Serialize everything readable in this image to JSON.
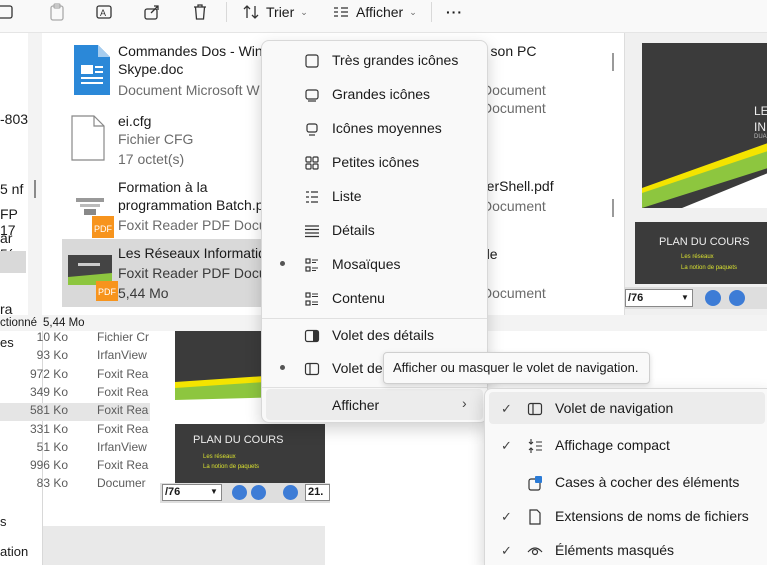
{
  "toolbar": {
    "sort_label": "Trier",
    "view_label": "Afficher",
    "more_label": "···"
  },
  "left_fragments": [
    "-803",
    "5 nf",
    "FP 17",
    "ar 5(",
    "ra Ph"
  ],
  "files": [
    {
      "name1": "Commandes Dos - Win",
      "name2": "Skype.doc",
      "sub1": "Document Microsoft W",
      "sub2": "",
      "icon": "word-doc-icon"
    },
    {
      "name1": "ei.cfg",
      "name2": "",
      "sub1": "Fichier CFG",
      "sub2": "17 octet(s)",
      "icon": "generic-file-icon"
    },
    {
      "name1": "Formation à la",
      "name2": "programmation Batch.p",
      "sub1": "Foxit Reader PDF Docu",
      "sub2": "",
      "icon": "pdf-file-icon"
    },
    {
      "name1": "Les Réseaux Informatiqu",
      "name2": "",
      "sub1": "Foxit Reader PDF Docur",
      "sub2": "5,44 Mo",
      "icon": "pdf-presentation-icon"
    }
  ],
  "right_fragments": {
    "r1": "r son PC",
    "r2": "Document",
    "r3": "Document",
    "r4": "rerShell.pdf",
    "r5": "Document",
    "r6": "de",
    "r7": "Document"
  },
  "status_bar": {
    "selected": "ctionné",
    "size": "5,44 Mo"
  },
  "lower_list": [
    {
      "size": "10 Ko",
      "app": "Fichier Cr"
    },
    {
      "size": "93 Ko",
      "app": "IrfanView"
    },
    {
      "size": "972 Ko",
      "app": "Foxit Rea"
    },
    {
      "size": "349 Ko",
      "app": "Foxit Rea"
    },
    {
      "size": "581 Ko",
      "app": "Foxit Rea"
    },
    {
      "size": "331 Ko",
      "app": "Foxit Rea"
    },
    {
      "size": "51 Ko",
      "app": "IrfanView"
    },
    {
      "size": "996 Ko",
      "app": "Foxit Rea"
    },
    {
      "size": "83 Ko",
      "app": "Documer"
    }
  ],
  "lower_left": [
    "es",
    "s",
    "ation"
  ],
  "preview": {
    "slide1_title": "LES",
    "slide1_line2": "INI",
    "slide1_line3": "DUA",
    "slide2_title": "PLAN DU COURS",
    "slide2_items": [
      "Les réseaux",
      "La notion de paquets"
    ],
    "page_field": "/76",
    "zoom_field": "21."
  },
  "view_menu": {
    "items": [
      {
        "label": "Très grandes icônes",
        "icon": "extra-large-icons-icon",
        "bullet": false
      },
      {
        "label": "Grandes icônes",
        "icon": "large-icons-icon",
        "bullet": false
      },
      {
        "label": "Icônes moyennes",
        "icon": "medium-icons-icon",
        "bullet": false
      },
      {
        "label": "Petites icônes",
        "icon": "small-icons-icon",
        "bullet": false
      },
      {
        "label": "Liste",
        "icon": "list-icon",
        "bullet": false
      },
      {
        "label": "Détails",
        "icon": "details-icon",
        "bullet": false
      },
      {
        "label": "Mosaïques",
        "icon": "tiles-icon",
        "bullet": true
      },
      {
        "label": "Contenu",
        "icon": "content-icon",
        "bullet": false
      }
    ],
    "pane_items": [
      {
        "label": "Volet des détails",
        "icon": "details-pane-icon",
        "bullet": false
      },
      {
        "label": "Volet de",
        "icon": "navigation-pane-icon",
        "bullet": true
      }
    ],
    "show_item": {
      "label": "Afficher",
      "chevron": "›"
    }
  },
  "tooltip": "Afficher ou masquer le volet de navigation.",
  "show_submenu": {
    "items": [
      {
        "label": "Volet de navigation",
        "icon": "navigation-pane-icon",
        "checked": true
      },
      {
        "label": "Affichage compact",
        "icon": "compact-view-icon",
        "checked": true
      },
      {
        "label": "Cases à cocher des éléments",
        "icon": "checkbox-icon",
        "checked": false
      },
      {
        "label": "Extensions de noms de fichiers",
        "icon": "file-extension-icon",
        "checked": true
      },
      {
        "label": "Éléments masqués",
        "icon": "hidden-items-icon",
        "checked": true
      }
    ]
  }
}
